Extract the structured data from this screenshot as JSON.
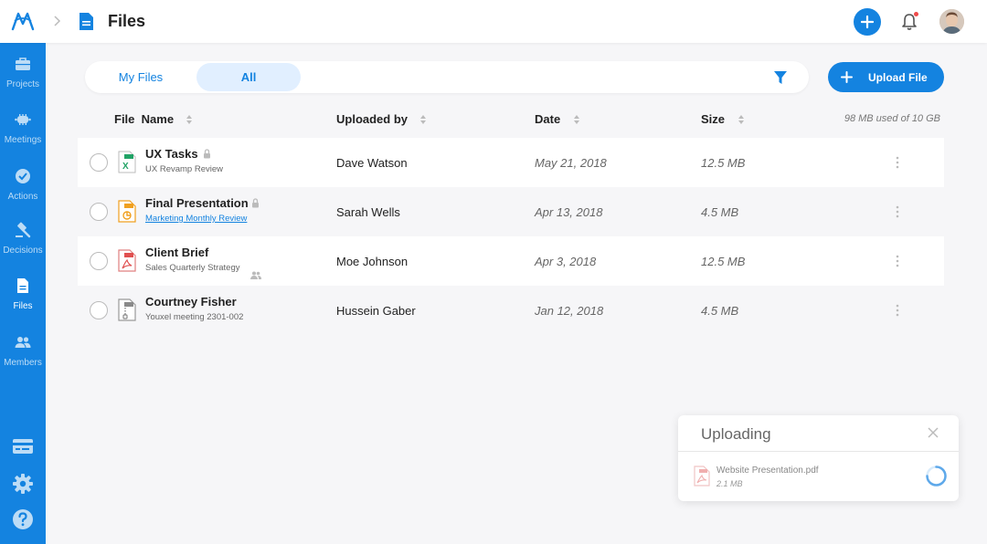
{
  "header": {
    "title": "Files",
    "logo_icon": "logo-icon",
    "page_icon": "document-icon",
    "avatar": "user-avatar"
  },
  "sidebar": {
    "items": [
      {
        "label": "Projects",
        "icon": "briefcase-icon"
      },
      {
        "label": "Meetings",
        "icon": "meetings-icon"
      },
      {
        "label": "Actions",
        "icon": "check-circle-icon"
      },
      {
        "label": "Decisions",
        "icon": "gavel-icon"
      },
      {
        "label": "Files",
        "icon": "document-icon",
        "active": true
      },
      {
        "label": "Members",
        "icon": "people-icon"
      }
    ],
    "bottom_icons": [
      "billing-icon",
      "settings-gear-icon",
      "help-icon"
    ]
  },
  "filters": {
    "tab_my_files": "My Files",
    "tab_all": "All",
    "active_tab": "All"
  },
  "upload_button": {
    "label": "Upload File"
  },
  "table": {
    "headers": {
      "file_name_prefix": "File",
      "file_name": "Name",
      "uploaded_by": "Uploaded by",
      "date": "Date",
      "size": "Size"
    },
    "storage_note": "98 MB used of 10 GB",
    "rows": [
      {
        "name": "UX Tasks",
        "subtitle": "UX Revamp Review",
        "uploaded_by": "Dave Watson",
        "date": "May 21, 2018",
        "size": "12.5 MB",
        "type": "excel",
        "locked": true
      },
      {
        "name": "Final Presentation",
        "subtitle": "Marketing Monthly Review",
        "uploaded_by": "Sarah Wells",
        "date": "Apr 13, 2018",
        "size": "4.5 MB",
        "type": "powerpoint",
        "locked": true,
        "subtitle_link": true
      },
      {
        "name": "Client Brief",
        "subtitle": "Sales Quarterly Strategy",
        "uploaded_by": "Moe Johnson",
        "date": "Apr 3, 2018",
        "size": "12.5 MB",
        "type": "pdf",
        "shared": true
      },
      {
        "name": "Courtney Fisher",
        "subtitle": "Youxel meeting 2301-002",
        "uploaded_by": "Hussein Gaber",
        "date": "Jan 12, 2018",
        "size": "4.5 MB",
        "type": "zip"
      }
    ]
  },
  "upload_panel": {
    "title": "Uploading",
    "file_name": "Website Presentation.pdf",
    "file_size": "2.1 MB"
  },
  "colors": {
    "brand": "#1483e0",
    "tab_active_bg": "#e1efff",
    "excel": "#21a366",
    "powerpoint": "#f0a020",
    "pdf": "#e05050",
    "zip": "#8a8a8a",
    "notification": "#ef4a4a"
  }
}
